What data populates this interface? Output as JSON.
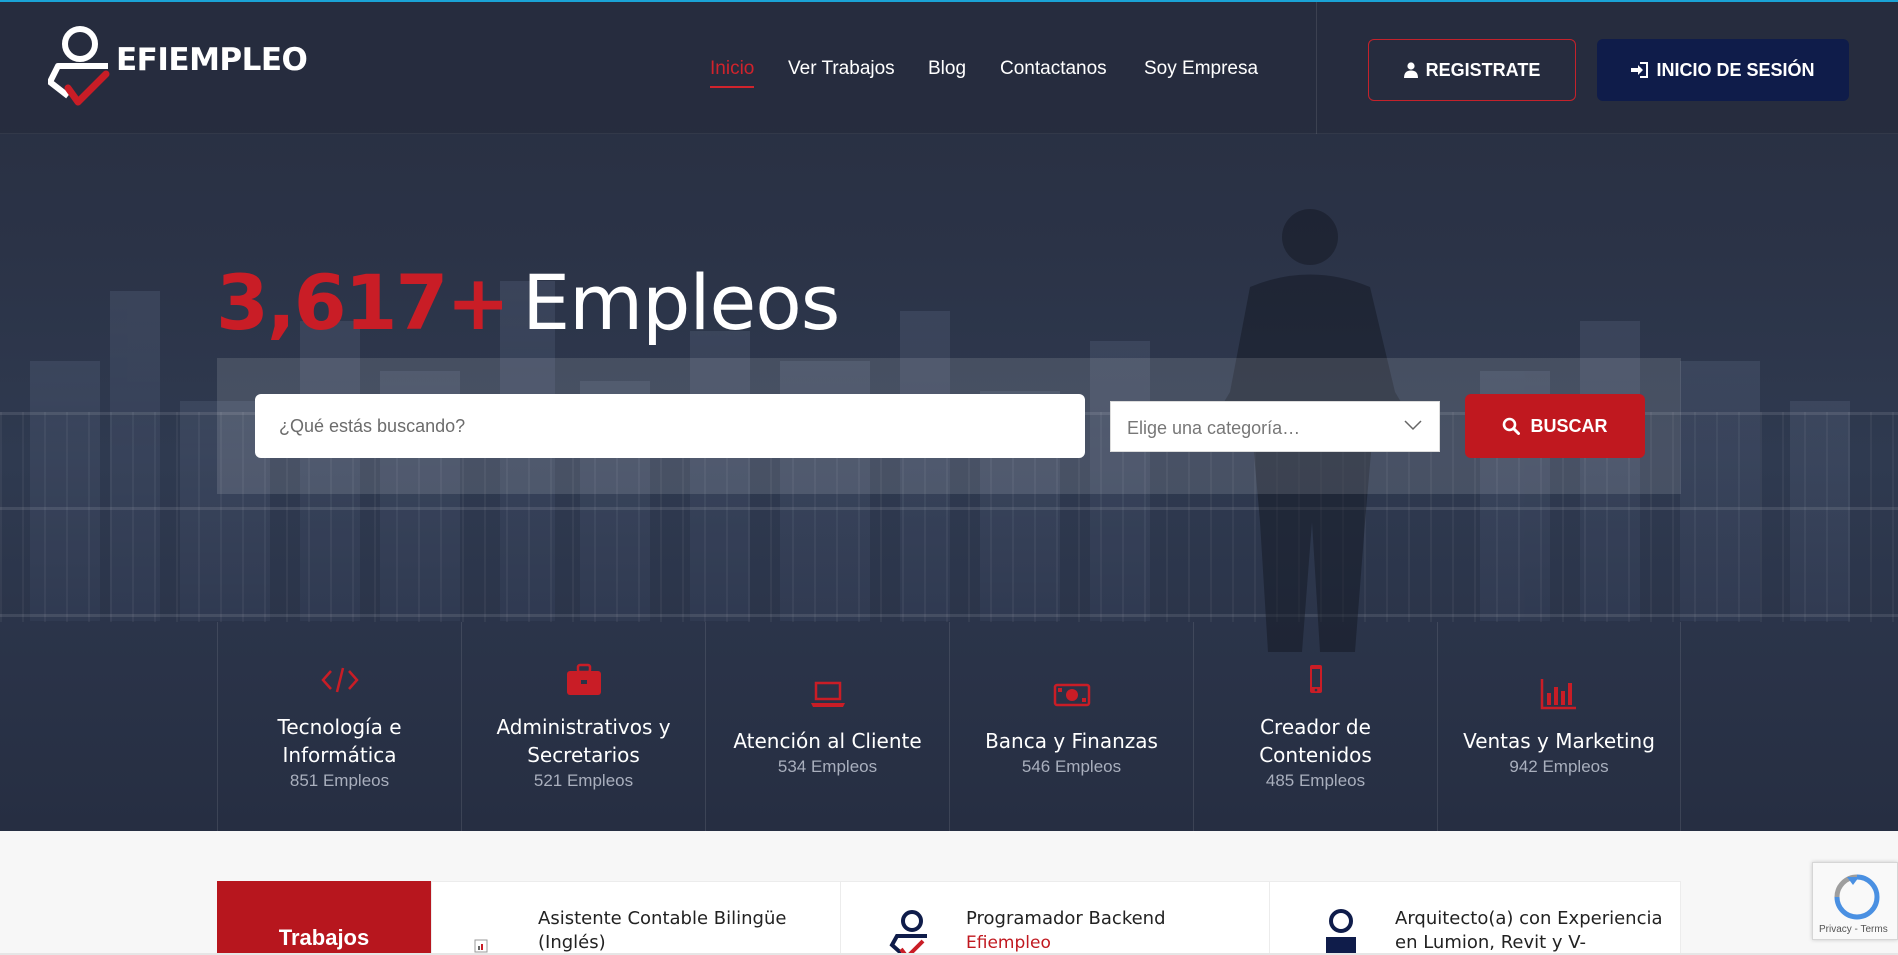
{
  "brand": {
    "name": "EFIEMPLEO",
    "accent": "#c91d26",
    "dark_navy": "#0f1c4a"
  },
  "nav": {
    "items": [
      {
        "label": "Inicio",
        "active": true
      },
      {
        "label": "Ver Trabajos",
        "active": false
      },
      {
        "label": "Blog",
        "active": false
      },
      {
        "label": "Contactanos",
        "active": false
      },
      {
        "label": "Soy Empresa",
        "active": false
      }
    ],
    "register_label": "REGISTRATE",
    "login_label": "INICIO DE SESIÓN"
  },
  "hero": {
    "count": "3,617+",
    "word": "Empleos"
  },
  "search": {
    "placeholder": "¿Qué estás buscando?",
    "category_placeholder": "Elige una categoría…",
    "button_label": "BUSCAR"
  },
  "categories": [
    {
      "title": "Tecnología e Informática",
      "count": "851 Empleos",
      "icon": "code-icon"
    },
    {
      "title": "Administrativos y Secretarios",
      "count": "521 Empleos",
      "icon": "briefcase-icon"
    },
    {
      "title": "Atención al Cliente",
      "count": "534 Empleos",
      "icon": "laptop-icon"
    },
    {
      "title": "Banca y Finanzas",
      "count": "546 Empleos",
      "icon": "money-icon"
    },
    {
      "title": "Creador de Contenidos",
      "count": "485 Empleos",
      "icon": "mobile-icon"
    },
    {
      "title": "Ventas y Marketing",
      "count": "942 Empleos",
      "icon": "bar-chart-icon"
    }
  ],
  "jobs": {
    "tab_label": "Trabajos",
    "items": [
      {
        "title": "Asistente Contable Bilingüe (Inglés)",
        "company": ""
      },
      {
        "title": "Programador Backend",
        "company": "Efiempleo"
      },
      {
        "title": "Arquitecto(a) con Experiencia en Lumion, Revit y V-",
        "company": ""
      }
    ]
  },
  "recaptcha": {
    "text": "Privacy - Terms"
  }
}
